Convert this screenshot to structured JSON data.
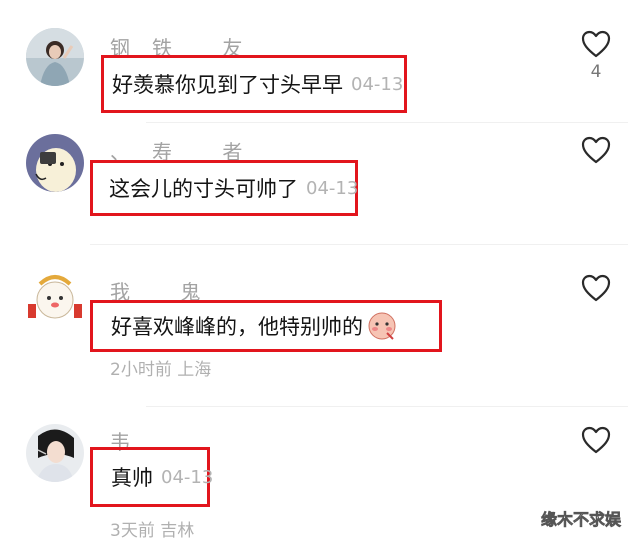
{
  "comments": [
    {
      "username": "钢铁 友",
      "text": "好羡慕你见到了寸头早早",
      "date": "04-13",
      "likes": "4"
    },
    {
      "username": "、寿 者",
      "text": "这会儿的寸头可帅了",
      "date": "04-13",
      "likes": ""
    },
    {
      "username": "我 鬼",
      "text": "好喜欢峰峰的，他特别帅的",
      "date": "",
      "meta": "2小时前 上海",
      "likes": ""
    },
    {
      "username": "韦",
      "text": "真帅",
      "date": "04-13",
      "meta": "3天前 吉林",
      "likes": ""
    }
  ],
  "watermark": "缘木不求娱",
  "colors": {
    "highlight": "#e2151d",
    "muted": "#a3a3a3"
  },
  "icons": {
    "like": "heart-outline-icon",
    "emoji": "blush-emoji-icon"
  }
}
